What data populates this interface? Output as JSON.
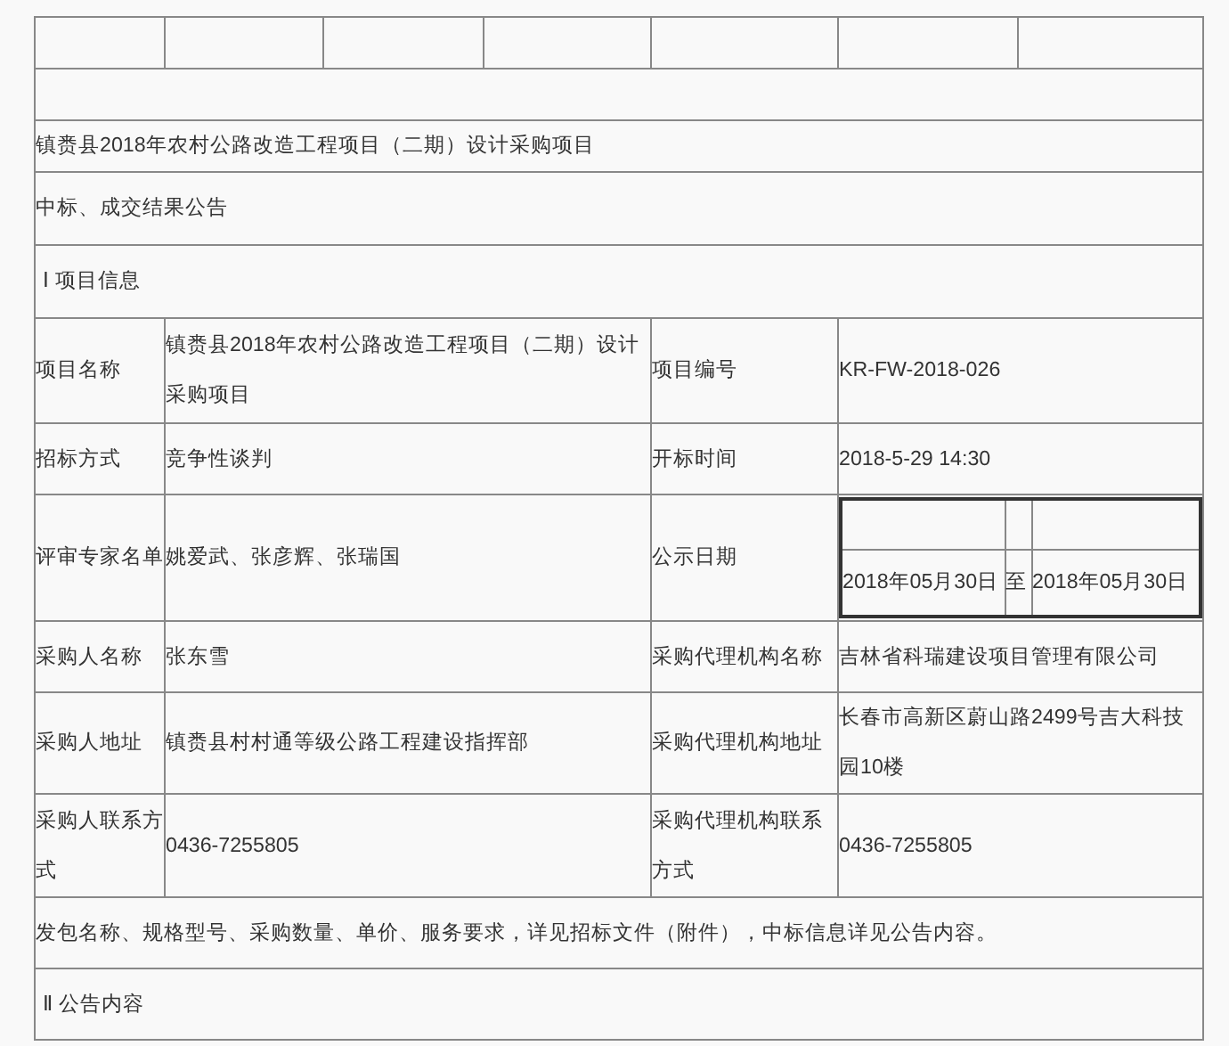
{
  "title": "镇赉县2018年农村公路改造工程项目（二期）设计采购项目",
  "subtitle": "中标、成交结果公告",
  "section_1": "Ⅰ 项目信息",
  "info_rows": [
    {
      "label": "项目名称",
      "value": "镇赉县2018年农村公路改造工程项目（二期）设计采购项目",
      "label_2": "项目编号",
      "value_2": "KR-FW-2018-026"
    },
    {
      "label": "招标方式",
      "value": "竞争性谈判",
      "label_2": "开标时间",
      "value_2": "2018-5-29 14:30"
    },
    {
      "label": "评审专家名单",
      "value": "姚爱武、张彦辉、张瑞国",
      "label_2": "公示日期",
      "period": {
        "start": "2018年05月30日",
        "separator": "至",
        "end": "2018年05月30日"
      }
    },
    {
      "label": "采购人名称",
      "value": "张东雪",
      "label_2": "采购代理机构名称",
      "value_2": "吉林省科瑞建设项目管理有限公司"
    },
    {
      "label": "采购人地址",
      "value": "镇赉县村村通等级公路工程建设指挥部",
      "label_2": "采购代理机构地址",
      "value_2": "长春市高新区蔚山路2499号吉大科技园10楼"
    },
    {
      "label": "采购人联系方式",
      "value": "0436-7255805",
      "label_2": "采购代理机构联系方式",
      "value_2": "0436-7255805"
    }
  ],
  "note": "发包名称、规格型号、采购数量、单价、服务要求，详见招标文件（附件），中标信息详见公告内容。",
  "section_2": "Ⅱ 公告内容"
}
